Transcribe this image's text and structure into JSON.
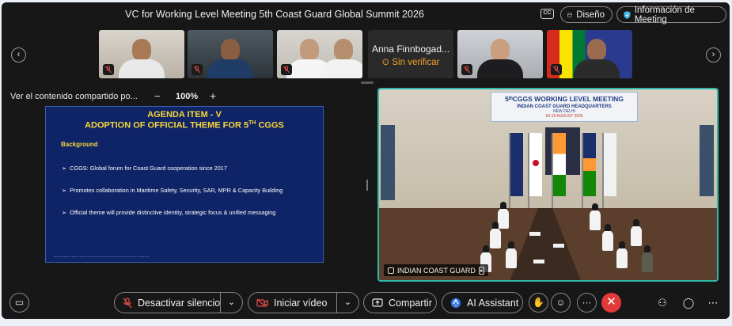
{
  "header": {
    "title": "VC for Working Level Meeting 5th Coast Guard Global Summit 2026",
    "cc_label": "CC",
    "design_label": "Diseño",
    "info_label": "Información de Meeting"
  },
  "participants": {
    "anna_name": "Anna Finnbogad...",
    "anna_status": "Sin verificar"
  },
  "shared": {
    "label": "Ver el contenido compartido po...",
    "zoom_minus": "−",
    "zoom": "100%",
    "zoom_plus": "+"
  },
  "slide": {
    "title_line1": "AGENDA ITEM - V",
    "title_line2": "ADOPTION OF OFFICIAL THEME FOR 5",
    "title_sup": "TH",
    "title_line2_end": " CGGS",
    "background_heading": "Background",
    "bullets": [
      "CGGS: Global forum for Coast Guard cooperation since 2017",
      "Promotes collaboration in Maritime Safety, Security, SAR, MPR & Capacity Building",
      "Official theme will provide distinctive identity, strategic focus & unified messaging"
    ]
  },
  "video": {
    "banner_line1": "5ᵗʰCGGS WORKING LEVEL MEETING",
    "banner_line2": "INDIAN COAST GUARD HEADQUARTERS",
    "banner_line3": "NEW DELHI",
    "banner_line4": "18-19 AUGUST 2026",
    "label": "INDIAN COAST GUARD"
  },
  "controls": {
    "mute_label": "Desactivar silencio",
    "video_label": "Iniciar vídeo",
    "share_label": "Compartir",
    "ai_label": "AI Assistant",
    "more_label": "···",
    "end_label": "✕"
  },
  "colors": {
    "accent_teal": "#2fb8a8",
    "end_red": "#e23a3a",
    "warning_orange": "#f0a02c",
    "slide_yellow": "#f7d63a",
    "slide_blue": "#0f2466"
  }
}
